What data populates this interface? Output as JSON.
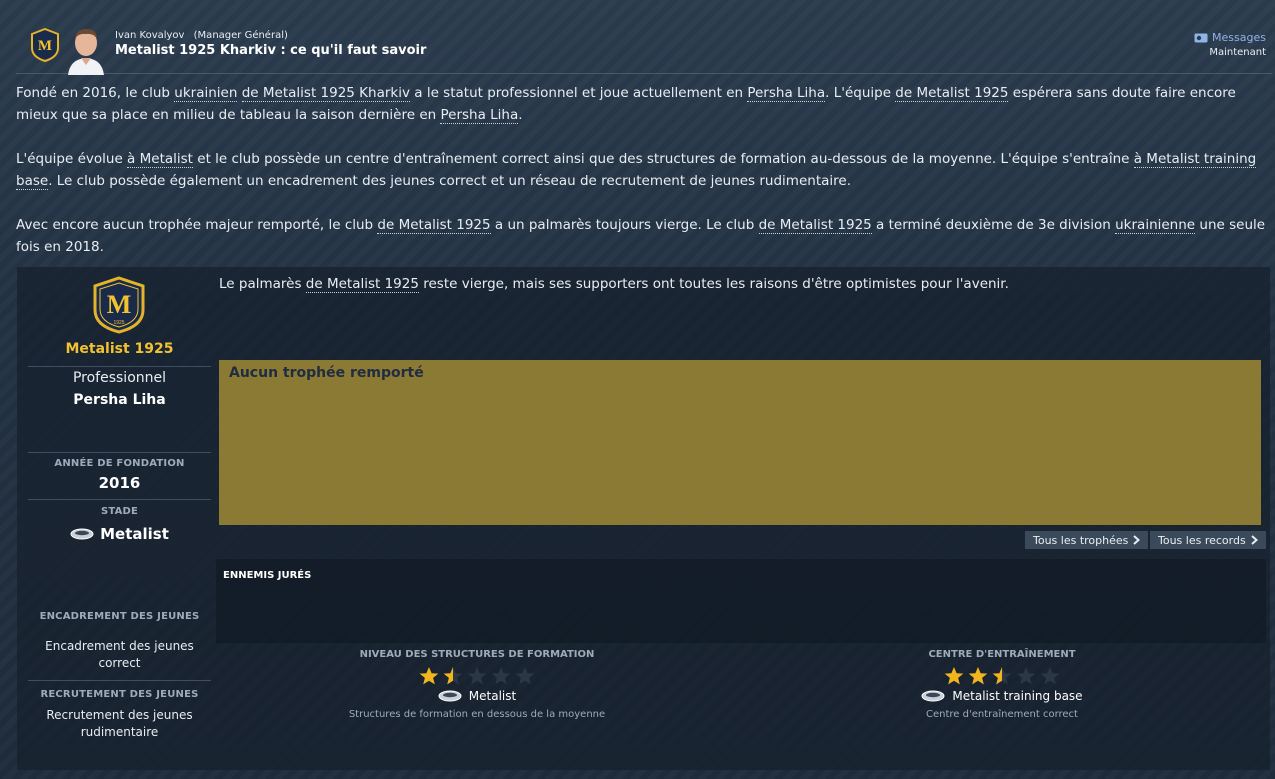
{
  "header": {
    "sender_name": "Ivan Kovalyov",
    "sender_role": "(Manager Général)",
    "subject": "Metalist 1925 Kharkiv : ce qu'il faut savoir",
    "messages_label": "Messages",
    "time": "Maintenant"
  },
  "intro": {
    "p1_a": "Fondé en 2016, le club ",
    "p1_link1": "ukrainien",
    "p1_b": " ",
    "p1_link2": "de Metalist 1925 Kharkiv",
    "p1_c": " a le statut professionnel et joue actuellement en ",
    "p1_link3": "Persha Liha",
    "p1_d": ". L'équipe ",
    "p1_link4": "de Metalist 1925",
    "p1_e": " espérera sans doute faire encore mieux que sa place en milieu de tableau la saison dernière en ",
    "p1_link5": "Persha Liha",
    "p1_f": ".",
    "p2_a": "L'équipe évolue ",
    "p2_link1": "à Metalist",
    "p2_b": " et le club possède un centre d'entraînement correct ainsi que des structures de formation au-dessous de la moyenne. L'équipe s'entraîne ",
    "p2_link2": "à Metalist training base",
    "p2_c": ". Le club possède également un encadrement des jeunes correct et un réseau de recrutement de jeunes rudimentaire.",
    "p3_a": "Avec encore aucun trophée majeur remporté, le club ",
    "p3_link1": "de Metalist 1925",
    "p3_b": " a un palmarès toujours vierge. Le club ",
    "p3_link2": "de Metalist 1925",
    "p3_c": " a terminé deuxième de 3e division ",
    "p3_link3": "ukrainienne",
    "p3_d": " une seule fois en 2018."
  },
  "club": {
    "name": "Metalist 1925",
    "badge_letter": "M",
    "badge_year": "1925",
    "status": "Professionnel",
    "league": "Persha Liha",
    "founded_label": "ANNÉE DE FONDATION",
    "founded_value": "2016",
    "stadium_label": "STADE",
    "stadium_value": "Metalist",
    "youth_coaching_label": "ENCADREMENT DES JEUNES",
    "youth_coaching_value": "Encadrement des jeunes correct",
    "youth_recruit_label": "RECRUTEMENT DES JEUNES",
    "youth_recruit_value": "Recrutement des jeunes rudimentaire"
  },
  "palmares": {
    "text_a": "Le palmarès ",
    "text_link": "de Metalist 1925",
    "text_b": " reste vierge, mais ses supporters ont toutes les raisons d'être optimistes pour l'avenir.",
    "no_trophy": "Aucun trophée remporté",
    "btn_trophies": "Tous les trophées",
    "btn_records": "Tous les records"
  },
  "enemies": {
    "label": "ENNEMIS JURÉS"
  },
  "facilities": {
    "youth": {
      "label": "NIVEAU DES STRUCTURES DE FORMATION",
      "rating": 1.5,
      "max": 5,
      "name": "Metalist",
      "desc": "Structures de formation en dessous de la moyenne"
    },
    "training": {
      "label": "CENTRE D'ENTRAÎNEMENT",
      "rating": 2.5,
      "max": 5,
      "name": "Metalist training base",
      "desc": "Centre d'entraînement correct"
    }
  },
  "colors": {
    "accent_gold": "#f2c230",
    "trophy_box": "#8b7a34",
    "link_blue": "#8fb4e6",
    "star_filled": "#f2b51e",
    "star_empty": "#2c3746"
  },
  "icons": {
    "messages": "envelope-icon",
    "chevron": "chevron-right-icon",
    "stadium": "stadium-icon",
    "star": "star-icon"
  }
}
